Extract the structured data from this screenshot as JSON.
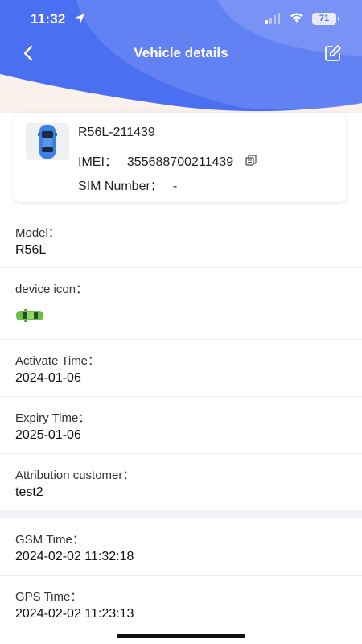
{
  "status_bar": {
    "time": "11:32",
    "battery": "71"
  },
  "nav": {
    "title": "Vehicle details"
  },
  "card": {
    "name": "R56L-211439",
    "imei_label": "IMEI：",
    "imei": "355688700211439",
    "sim_label": "SIM Number：",
    "sim": "-"
  },
  "fields": {
    "model": {
      "label": "Model：",
      "value": "R56L"
    },
    "device_icon": {
      "label": "device icon："
    },
    "activate_time": {
      "label": "Activate Time：",
      "value": "2024-01-06"
    },
    "expiry_time": {
      "label": "Expiry Time：",
      "value": "2025-01-06"
    },
    "attribution_customer": {
      "label": "Attribution customer：",
      "value": "test2"
    },
    "gsm_time": {
      "label": "GSM Time：",
      "value": "2024-02-02 11:32:18"
    },
    "gps_time": {
      "label": "GPS Time：",
      "value": "2024-02-02 11:23:13"
    }
  },
  "colors": {
    "header_blue": "#4a6ff0",
    "header_light": "#7d96f5",
    "bg_peach": "#fbf1ec"
  },
  "icons": [
    "back-arrow-icon",
    "edit-icon",
    "copy-icon",
    "car-icon",
    "location-arrow-icon",
    "signal-icon",
    "wifi-icon"
  ]
}
